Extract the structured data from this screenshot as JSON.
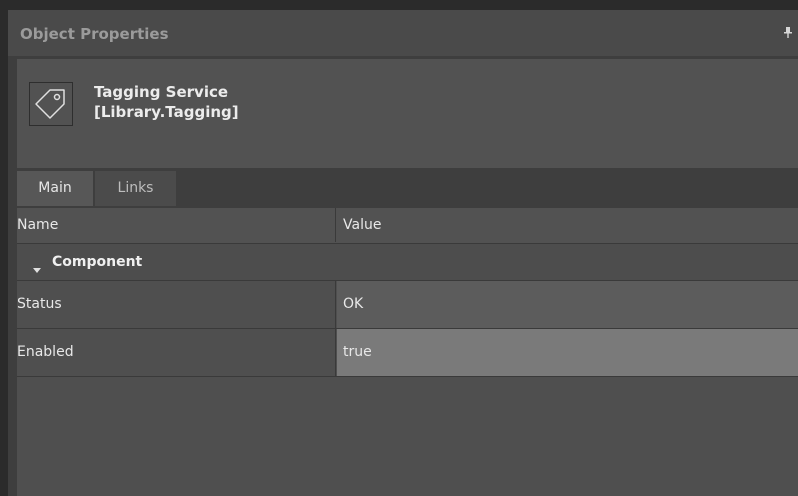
{
  "panel": {
    "title": "Object Properties",
    "pin_icon": "pin-icon"
  },
  "object": {
    "icon": "tag-icon",
    "name": "Tagging Service",
    "type": "[Library.Tagging]"
  },
  "tabs": [
    {
      "label": "Main",
      "active": true
    },
    {
      "label": "Links",
      "active": false
    }
  ],
  "grid": {
    "columns": [
      "Name",
      "Value"
    ],
    "category": {
      "label": "Component",
      "expanded": true
    },
    "rows": [
      {
        "name": "Status",
        "value": "OK"
      },
      {
        "name": "Enabled",
        "value": "true"
      }
    ]
  }
}
